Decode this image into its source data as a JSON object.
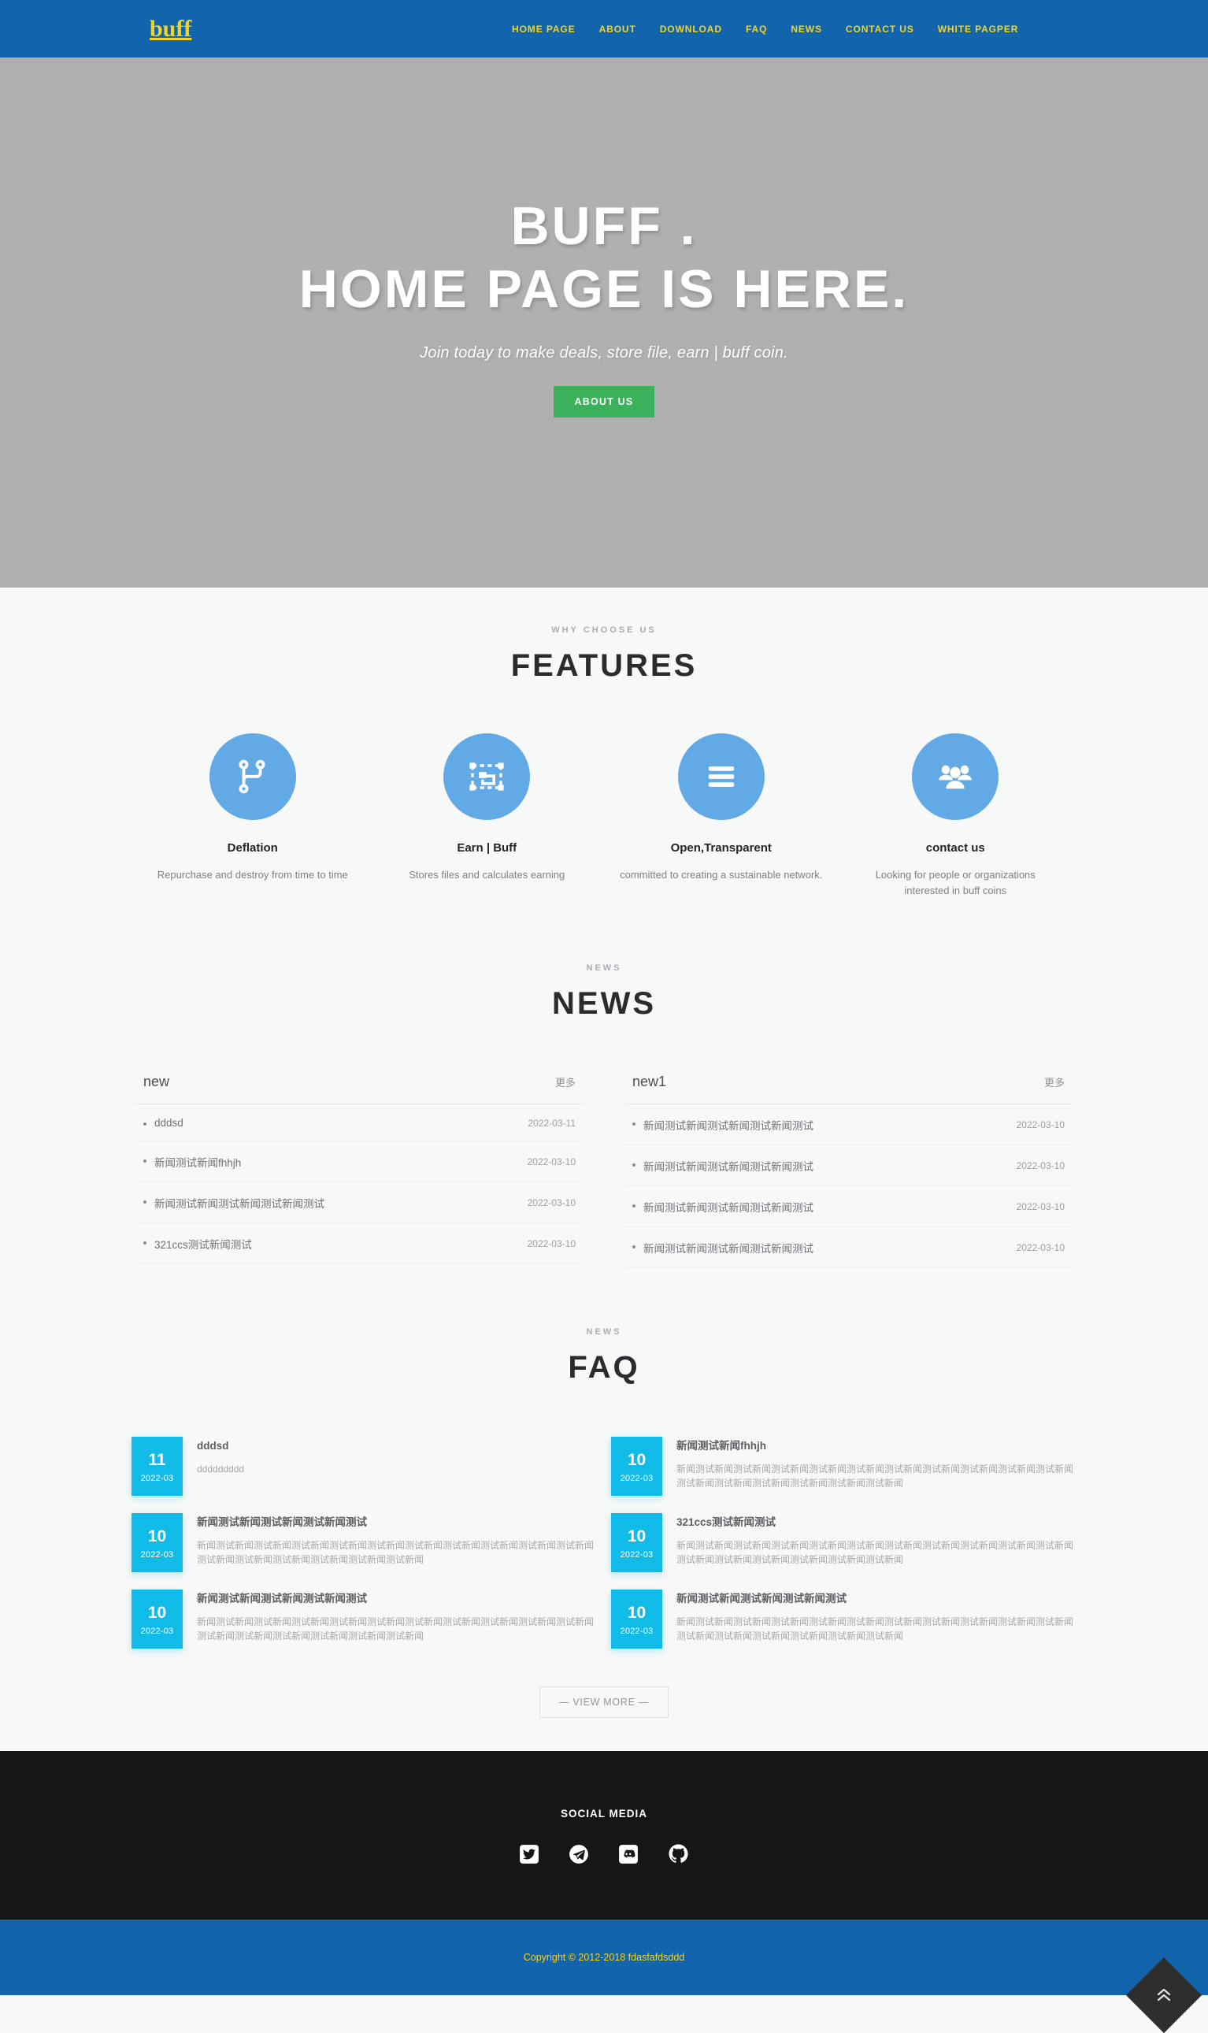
{
  "navbar": {
    "brand": "buff",
    "links": [
      {
        "label": "HOME PAGE"
      },
      {
        "label": "ABOUT"
      },
      {
        "label": "DOWNLOAD"
      },
      {
        "label": "FAQ"
      },
      {
        "label": "NEWS"
      },
      {
        "label": "CONTACT US"
      },
      {
        "label": "WHITE PAGPER"
      }
    ],
    "bg_color": "#1264ac",
    "link_color": "#f3d424"
  },
  "hero": {
    "title_line1": "BUFF .",
    "title_line2": "HOME PAGE IS HERE.",
    "tagline": "Join today to make deals, store file, earn | buff coin.",
    "cta_label": "ABOUT US",
    "cta_color": "#3cb15b",
    "bg_color": "#b0b0b0"
  },
  "features": {
    "eyebrow": "WHY CHOOSE US",
    "title": "FEATURES",
    "icon_bg": "#62aae6",
    "items": [
      {
        "icon": "code-branch-icon",
        "title": "Deflation",
        "desc": "Repurchase and destroy from time to time"
      },
      {
        "icon": "object-group-icon",
        "title": "Earn | Buff",
        "desc": "Stores files and calculates earning"
      },
      {
        "icon": "bars-icon",
        "title": "Open,Transparent",
        "desc": "committed to creating a sustainable network."
      },
      {
        "icon": "users-icon",
        "title": "contact us",
        "desc": "Looking for people or organizations interested in buff coins"
      }
    ]
  },
  "news": {
    "eyebrow": "NEWS",
    "title": "NEWS",
    "columns": [
      {
        "heading": "new",
        "more_label": "更多",
        "items": [
          {
            "text": "dddsd",
            "date": "2022-03-11"
          },
          {
            "text": "新闻测试新闻fhhjh",
            "date": "2022-03-10"
          },
          {
            "text": "新闻测试新闻测试新闻测试新闻测试",
            "date": "2022-03-10"
          },
          {
            "text": "321ccs测试新闻测试",
            "date": "2022-03-10"
          }
        ]
      },
      {
        "heading": "new1",
        "more_label": "更多",
        "items": [
          {
            "text": "新闻测试新闻测试新闻测试新闻测试",
            "date": "2022-03-10"
          },
          {
            "text": "新闻测试新闻测试新闻测试新闻测试",
            "date": "2022-03-10"
          },
          {
            "text": "新闻测试新闻测试新闻测试新闻测试",
            "date": "2022-03-10"
          },
          {
            "text": "新闻测试新闻测试新闻测试新闻测试",
            "date": "2022-03-10"
          }
        ]
      }
    ]
  },
  "faq": {
    "eyebrow": "NEWS",
    "title": "FAQ",
    "date_badge_color": "#11bbe8",
    "items": [
      {
        "day": "11",
        "month": "2022-03",
        "title": "dddsd",
        "desc": "ddddddddd"
      },
      {
        "day": "10",
        "month": "2022-03",
        "title": "新闻测试新闻fhhjh",
        "desc": "新闻测试新闻测试新闻测试新闻测试新闻测试新闻测试新闻测试新闻测试新闻测试新闻测试新闻测试新闻测试新闻测试新闻测试新闻测试新闻测试新闻"
      },
      {
        "day": "10",
        "month": "2022-03",
        "title": "新闻测试新闻测试新闻测试新闻测试",
        "desc": "新闻测试新闻测试新闻测试新闻测试新闻测试新闻测试新闻测试新闻测试新闻测试新闻测试新闻测试新闻测试新闻测试新闻测试新闻测试新闻测试新闻"
      },
      {
        "day": "10",
        "month": "2022-03",
        "title": "321ccs测试新闻测试",
        "desc": "新闻测试新闻测试新闻测试新闻测试新闻测试新闻测试新闻测试新闻测试新闻测试新闻测试新闻测试新闻测试新闻测试新闻测试新闻测试新闻测试新闻"
      },
      {
        "day": "10",
        "month": "2022-03",
        "title": "新闻测试新闻测试新闻测试新闻测试",
        "desc": "新闻测试新闻测试新闻测试新闻测试新闻测试新闻测试新闻测试新闻测试新闻测试新闻测试新闻测试新闻测试新闻测试新闻测试新闻测试新闻测试新闻"
      },
      {
        "day": "10",
        "month": "2022-03",
        "title": "新闻测试新闻测试新闻测试新闻测试",
        "desc": "新闻测试新闻测试新闻测试新闻测试新闻测试新闻测试新闻测试新闻测试新闻测试新闻测试新闻测试新闻测试新闻测试新闻测试新闻测试新闻测试新闻"
      }
    ],
    "view_more_label": "— VIEW MORE —"
  },
  "footer": {
    "social_title": "SOCIAL MEDIA",
    "socials": [
      {
        "icon": "twitter-icon"
      },
      {
        "icon": "telegram-icon"
      },
      {
        "icon": "discord-icon"
      },
      {
        "icon": "github-icon"
      }
    ],
    "copyright": "Copyright © 2012-2018 fdasfafdsddd",
    "bar_color": "#1264ac",
    "bg_color": "#151617",
    "to_top_icon": "double-chevron-up-icon"
  }
}
